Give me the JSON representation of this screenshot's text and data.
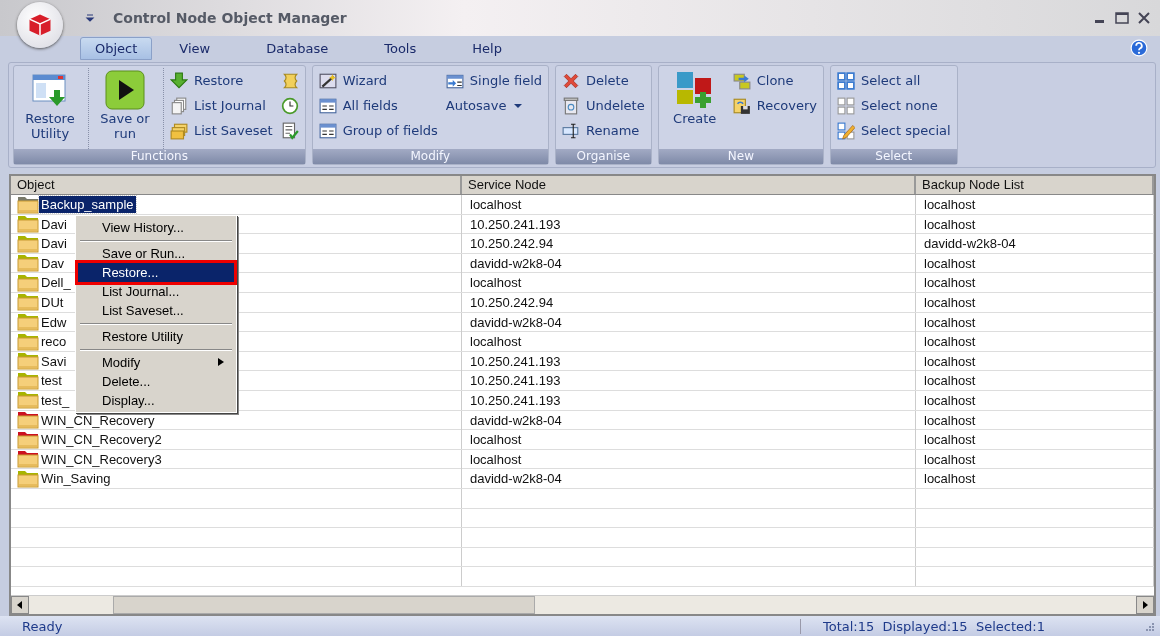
{
  "window": {
    "title": "Control Node Object Manager"
  },
  "menu_tabs": [
    {
      "label": "Object",
      "selected": true
    },
    {
      "label": "View",
      "selected": false
    },
    {
      "label": "Database",
      "selected": false
    },
    {
      "label": "Tools",
      "selected": false
    },
    {
      "label": "Help",
      "selected": false
    }
  ],
  "ribbon": [
    {
      "label": "Functions",
      "columns": [
        [
          {
            "kind": "large",
            "label": "Restore Utility"
          }
        ],
        [
          {
            "kind": "large",
            "label": "Save or run"
          }
        ],
        [
          {
            "kind": "small",
            "label": "Restore"
          },
          {
            "kind": "small",
            "label": "List Journal"
          },
          {
            "kind": "small",
            "label": "List Saveset"
          }
        ],
        [
          {
            "kind": "icon"
          },
          {
            "kind": "icon"
          },
          {
            "kind": "icon"
          }
        ]
      ]
    },
    {
      "label": "Modify",
      "columns": [
        [
          {
            "kind": "small",
            "label": "Wizard"
          },
          {
            "kind": "small",
            "label": "All fields"
          },
          {
            "kind": "small",
            "label": "Group of fields"
          }
        ],
        [
          {
            "kind": "small",
            "label": "Single field"
          },
          {
            "kind": "dropdown",
            "label": "Autosave"
          }
        ]
      ]
    },
    {
      "label": "Organise",
      "columns": [
        [
          {
            "kind": "small",
            "label": "Delete"
          },
          {
            "kind": "small",
            "label": "Undelete"
          },
          {
            "kind": "small",
            "label": "Rename"
          }
        ]
      ]
    },
    {
      "label": "New",
      "columns": [
        [
          {
            "kind": "large",
            "label": "Create"
          }
        ],
        [
          {
            "kind": "small",
            "label": "Clone"
          },
          {
            "kind": "small",
            "label": "Recovery"
          }
        ]
      ]
    },
    {
      "label": "Select",
      "columns": [
        [
          {
            "kind": "small",
            "label": "Select all"
          },
          {
            "kind": "small",
            "label": "Select none"
          },
          {
            "kind": "small",
            "label": "Select special"
          }
        ]
      ]
    }
  ],
  "table": {
    "columns": [
      "Object",
      "Service Node",
      "Backup Node List"
    ],
    "rows": [
      {
        "object": "Backup_sample",
        "service_node": "localhost",
        "backup_node_list": "localhost",
        "selected": true,
        "color": "#7a7a6a"
      },
      {
        "object": "Davi",
        "service_node": "10.250.241.193",
        "backup_node_list": "localhost",
        "selected": false,
        "color": "#a8b400"
      },
      {
        "object": "Davi",
        "service_node": "10.250.242.94",
        "backup_node_list": "davidd-w2k8-04",
        "selected": false,
        "color": "#a8b400"
      },
      {
        "object": "Dav",
        "service_node": "davidd-w2k8-04",
        "backup_node_list": "localhost",
        "selected": false,
        "color": "#a8b400"
      },
      {
        "object": "Dell_",
        "service_node": "localhost",
        "backup_node_list": "localhost",
        "selected": false,
        "color": "#a8b400"
      },
      {
        "object": "DUt",
        "service_node": "10.250.242.94",
        "backup_node_list": "localhost",
        "selected": false,
        "color": "#a8b400"
      },
      {
        "object": "Edw",
        "service_node": "davidd-w2k8-04",
        "backup_node_list": "localhost",
        "selected": false,
        "color": "#a8b400"
      },
      {
        "object": "reco",
        "service_node": "localhost",
        "backup_node_list": "localhost",
        "selected": false,
        "color": "#a8b400"
      },
      {
        "object": "Savi",
        "service_node": "10.250.241.193",
        "backup_node_list": "localhost",
        "selected": false,
        "color": "#a8b400"
      },
      {
        "object": "test",
        "service_node": "10.250.241.193",
        "backup_node_list": "localhost",
        "selected": false,
        "color": "#a8b400"
      },
      {
        "object": "test_",
        "service_node": "10.250.241.193",
        "backup_node_list": "localhost",
        "selected": false,
        "color": "#a8b400"
      },
      {
        "object": "WIN_CN_Recovery",
        "service_node": "davidd-w2k8-04",
        "backup_node_list": "localhost",
        "selected": false,
        "color": "#cc1020"
      },
      {
        "object": "WIN_CN_Recovery2",
        "service_node": "localhost",
        "backup_node_list": "localhost",
        "selected": false,
        "color": "#cc1020"
      },
      {
        "object": "WIN_CN_Recovery3",
        "service_node": "localhost",
        "backup_node_list": "localhost",
        "selected": false,
        "color": "#cc1020"
      },
      {
        "object": "Win_Saving",
        "service_node": "davidd-w2k8-04",
        "backup_node_list": "localhost",
        "selected": false,
        "color": "#a8b400"
      }
    ]
  },
  "context_menu": [
    {
      "kind": "item",
      "label": "View History...",
      "selected": false,
      "outlined": false
    },
    {
      "kind": "separator"
    },
    {
      "kind": "item",
      "label": "Save or Run...",
      "selected": false,
      "outlined": false
    },
    {
      "kind": "item",
      "label": "Restore...",
      "selected": true,
      "outlined": true
    },
    {
      "kind": "item",
      "label": "List Journal...",
      "selected": false,
      "outlined": false
    },
    {
      "kind": "item",
      "label": "List Saveset...",
      "selected": false,
      "outlined": false
    },
    {
      "kind": "separator"
    },
    {
      "kind": "item",
      "label": "Restore Utility",
      "selected": false,
      "outlined": false
    },
    {
      "kind": "separator"
    },
    {
      "kind": "submenu",
      "label": "Modify",
      "selected": false,
      "outlined": false
    },
    {
      "kind": "item",
      "label": "Delete...",
      "selected": false,
      "outlined": false
    },
    {
      "kind": "item",
      "label": "Display...",
      "selected": false,
      "outlined": false
    }
  ],
  "status_bar": {
    "message": "Ready",
    "counts": "Total:15  Displayed:15  Selected:1"
  }
}
